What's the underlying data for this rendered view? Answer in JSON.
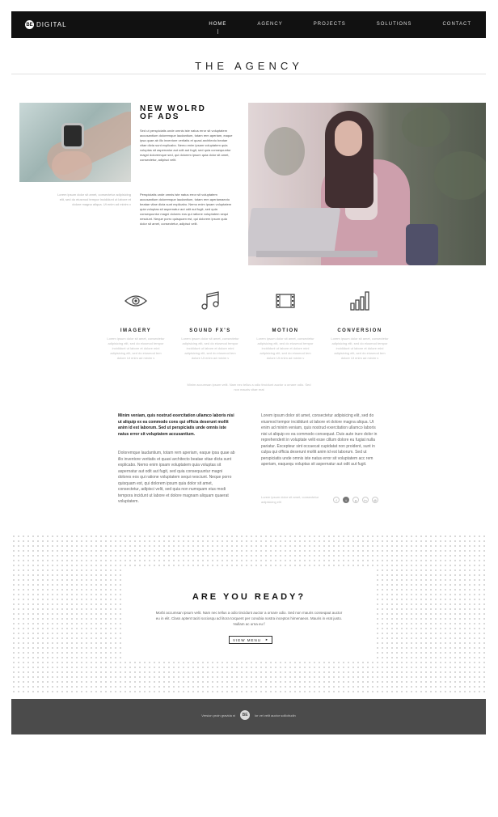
{
  "nav": {
    "logo_mark": "BE",
    "logo_text": "DIGITAL",
    "items": [
      {
        "label": "HOME",
        "active": true
      },
      {
        "label": "AGENCY"
      },
      {
        "label": "PROJECTS"
      },
      {
        "label": "SOLUTIONS"
      },
      {
        "label": "CONTACT"
      }
    ]
  },
  "page_title": "THE AGENCY",
  "intro": {
    "headline_line1": "NEW WOLRD",
    "headline_line2": "OF ADS",
    "paragraph_a": "Sed ut perspiciatis unde omnis iste natus error sit voluptatem accusantium doloremque laudantium, totam rem aperiam, eaque ipsa quae ab illo inventore veritatis et quasi architecto beatae vitae dicta sunt explicabo. Nemo enim ipsam voluptatem quia voluptas sit aspernatur aut odit aut fugit, sed quia consequuntur magni doloremque sed, qui dolorem ipsum quia dolor sit amet, consectetur, adipisci velit.",
    "paragraph_b": "Perspiciatis unde omnis iste natus error sit voluptatem accusantium doloremque laudantium, totam rem aperiamaecto beatae vitae dicta sunt explicabo. Nemo enim ipsam voluptatem quia voluptas sit aspernatur aut odit aut fugit, sed quia consequuntur magni dolores eos qui ratione voluptatem sequi nesciunt. Neque porro quisquam est, qui dolorem ipsum quia dolor sit amet, consectetur, adipisci velit.",
    "watch_caption": "Lorem ipsum dolor sit amet, consectetur adipisicing elit, sed do eiusmod tempor incididunt ut labore et dolore magna aliqua. Ut enim ad minim v"
  },
  "services": [
    {
      "icon": "eye-icon",
      "title": "IMAGERY",
      "desc": "Lorem ipsum dolor sit amet, consectetur adipisicing elit, sed do eiusmod tempor incididunt ut labore et dolore mini adipisicing elit, sed do eiusmod tem dolore Ut enim ad minim v"
    },
    {
      "icon": "music-note-icon",
      "title": "SOUND FX'S",
      "desc": "Lorem ipsum dolor sit amet, consectetur adipisicing elit, sed do eiusmod tempor incididunt ut labore et dolore mini adipisicing elit, sed do eiusmod tem dolore Ut enim ad minim v"
    },
    {
      "icon": "film-icon",
      "title": "MOTION",
      "desc": "Lorem ipsum dolor sit amet, consectetur adipisicing elit, sed do eiusmod tempor incididunt ut labore et dolore mini adipisicing elit, sed do eiusmod tem dolore Ut enim ad minim v"
    },
    {
      "icon": "bar-chart-icon",
      "title": "CONVERSION",
      "desc": "Lorem ipsum dolor sit amet, consectetur adipisicing elit, sed do eiusmod tempor incididunt ut labore et dolore mini adipisicing elit, sed do eiusmod tem dolore Ut enim ad minim v"
    }
  ],
  "services_note": "Minim accumsan ipsum velit. Nam nec tellus a odio tincidunt auctor a ornare odio. Sed non mauris vitae erat",
  "columns": {
    "left_lead": "Minim veniam, quis nostrud exercitation ullamco laboris nisi ut aliquip ex ea commodo cons qui officia deserunt mollit anim id est laborum. Sed ut perspiciatis unde omnis iste natus error sit voluptatem accusantium.",
    "left_body": "Doloremque laudantium, totam rem aperiam, eaque ipsa quae ab illo inventore veritatis et quasi architecto beatae vitae dicta sunt explicabo. Nemo enim ipsam voluptatem quia voluptas sit aspernatur aut odit aut fugit, sed quia consequuntur magni dolores eos qui ratione voluptatem sequi nesciunt. Neque porro quisquam est, qui dolorem ipsum quia dolor sit amet, consectetur, adipisci velit, sed quia non numquam eius modi tempora incidunt ut labore et dolore magnam aliquam quaerat voluptatem.",
    "right_body": "Lorem ipsum dolor sit amet, consectetur adipisicing elit, sed do eiusmod tempor incididunt ut labore et dolore magna aliqua. Ut enim ad minim veniam, quis nostrud exercitation ullamco laboris nisi ut aliquip ex ea commodo consequat. Duis aute irure dolor in reprehenderit in voluptate velit esse cillum dolore eu fugiat nulla pariatur. Excepteur sint occaecat cupidatat non proident, sunt in culpa qui officia deserunt mollit anim id est laborum. Sed ut perspiciatis unde omnis iste natus error sit voluptatem acc rem aperiam, eaquequ voluptas sit aspernatur aut odit aut fugit.",
    "right_caption": "Lorem ipsum dolor sit amet, consectetur adipisicing elit",
    "social_icons": [
      "facebook-icon",
      "twitter-icon",
      "google-plus-icon",
      "linkedin-icon",
      "mail-icon"
    ]
  },
  "cta": {
    "title": "ARE YOU READY?",
    "text": "Morbi accumsan ipsum velit. Nam nec tellus a odio tincidunt auctor a ornare odio. Sed non mauris conseqaut auctor eu in elit. Class aptent taciti sociosqu ad litora torquent per conubia nostra inceptos himenaeos. Mauris in erat justo. Nullam ac urna eu f",
    "button_label": "VIEW MENU",
    "button_caret": "▸"
  },
  "footer": {
    "text_left": "Version proin gravida ni",
    "logo_mark": "BE",
    "text_right": "lor vel velit auctor sollicitudin"
  },
  "colors": {
    "nav_bg": "#111111",
    "footer_bg": "#4b4b4b",
    "accent": "#222222"
  }
}
